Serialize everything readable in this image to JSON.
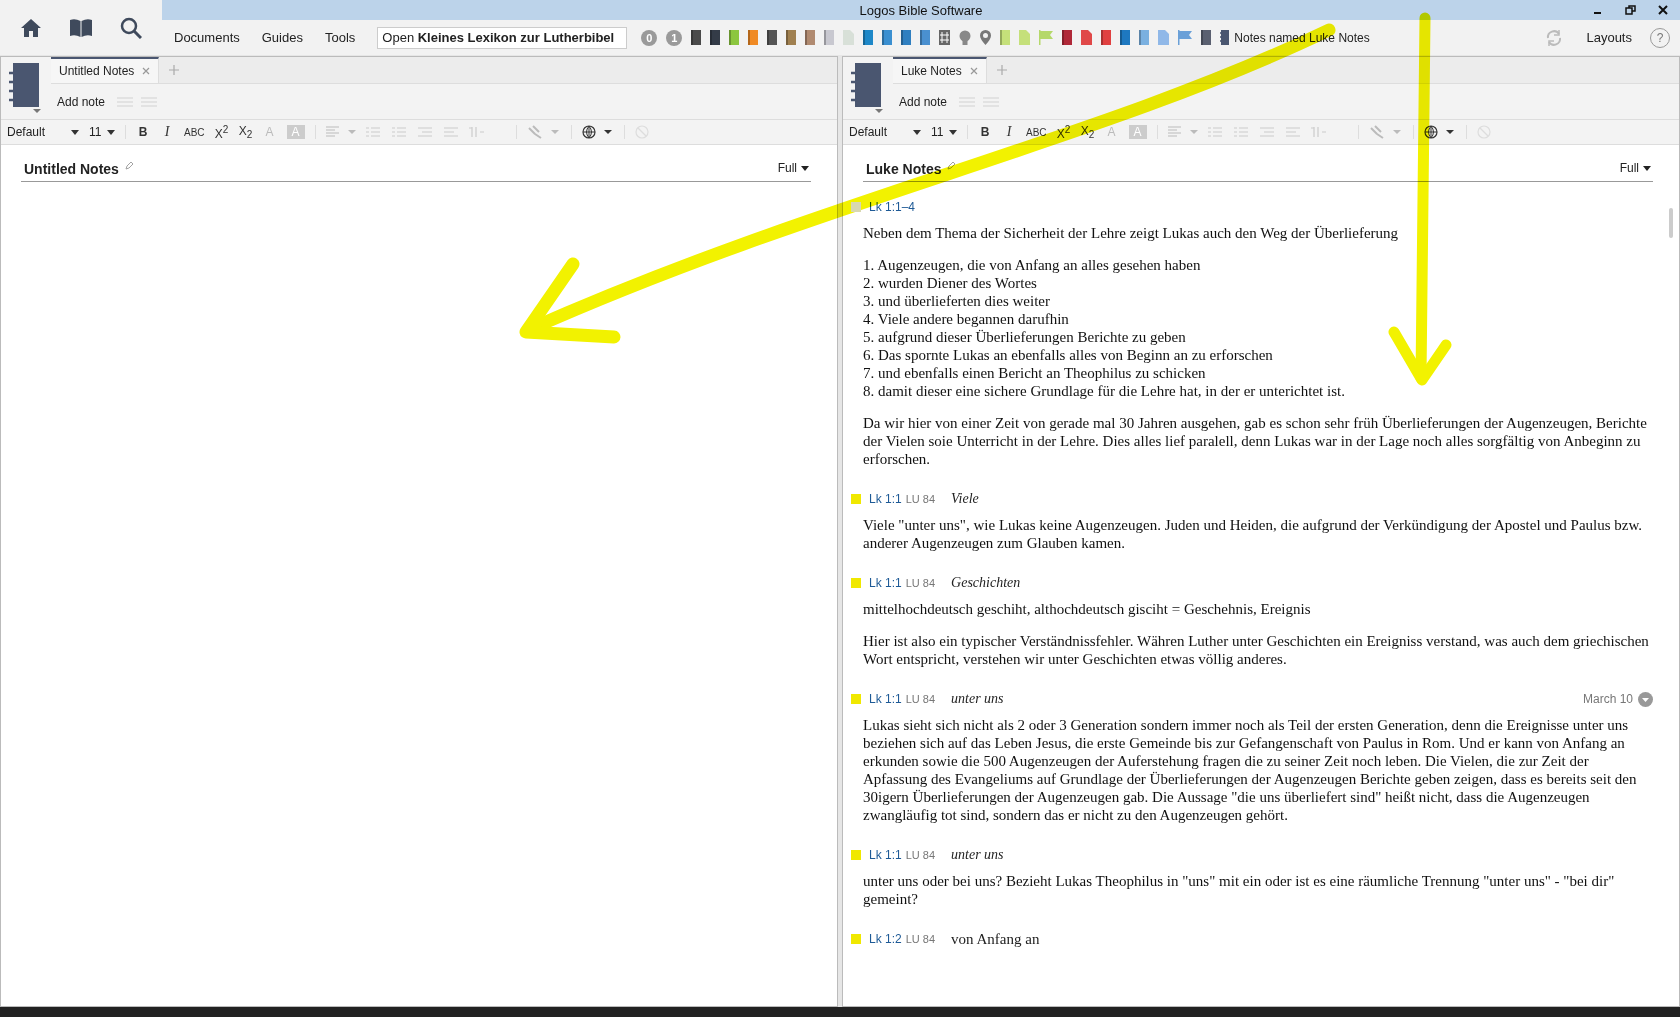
{
  "window": {
    "title": "Logos Bible Software"
  },
  "menu": [
    {
      "label": "Documents"
    },
    {
      "label": "Guides"
    },
    {
      "label": "Tools"
    }
  ],
  "command_box": {
    "value": "Open **Kleines Lexikon zur Lutherbibel**"
  },
  "shortcuts": [
    {
      "kind": "badge",
      "label": "0",
      "color": "#9a9a9a"
    },
    {
      "kind": "badge",
      "label": "1",
      "color": "#9a9a9a"
    },
    {
      "kind": "book",
      "color": "#4a4a4a"
    },
    {
      "kind": "book",
      "color": "#343c48"
    },
    {
      "kind": "book",
      "color": "#8cc63f"
    },
    {
      "kind": "book",
      "color": "#f08a24"
    },
    {
      "kind": "book",
      "color": "#555555"
    },
    {
      "kind": "book",
      "color": "#a08050"
    },
    {
      "kind": "book",
      "color": "#b08a70"
    },
    {
      "kind": "book",
      "color": "#c8c8d0"
    },
    {
      "kind": "doc",
      "color": "#d8e0d8"
    },
    {
      "kind": "book",
      "color": "#1e88c8"
    },
    {
      "kind": "book",
      "color": "#3a8fd0"
    },
    {
      "kind": "book",
      "color": "#2f7fc0"
    },
    {
      "kind": "book",
      "color": "#4a90d0"
    },
    {
      "kind": "grid",
      "color": "#666666"
    },
    {
      "kind": "bulb",
      "color": "#888888"
    },
    {
      "kind": "pin",
      "color": "#777777"
    },
    {
      "kind": "book",
      "color": "#c5e07a"
    },
    {
      "kind": "doc",
      "color": "#c5e07a"
    },
    {
      "kind": "flag",
      "color": "#b5d86a"
    },
    {
      "kind": "book",
      "color": "#b02838"
    },
    {
      "kind": "doc",
      "color": "#e04848"
    },
    {
      "kind": "book",
      "color": "#e04040"
    },
    {
      "kind": "book",
      "color": "#1e78c0"
    },
    {
      "kind": "book",
      "color": "#7ab0e0"
    },
    {
      "kind": "doc",
      "color": "#90b8e8"
    },
    {
      "kind": "flag",
      "color": "#6aa0d8"
    },
    {
      "kind": "book",
      "color": "#5a6070"
    }
  ],
  "notes_shortcut": {
    "label": "Notes named Luke Notes"
  },
  "layouts": {
    "label": "Layouts"
  },
  "help": {
    "label": "?"
  },
  "panels": [
    {
      "tab": {
        "label": "Untitled Notes",
        "selected": true
      },
      "add_note": "Add note",
      "toolbar": {
        "font": "Default",
        "size": "11",
        "buttons": [
          {
            "kind": "bold",
            "label": "B",
            "disabled": false
          },
          {
            "kind": "italic",
            "label": "I",
            "disabled": false
          },
          {
            "kind": "caps",
            "label": "ABC",
            "disabled": false
          },
          {
            "kind": "sup",
            "label": "X$^{2}$",
            "disabled": false
          },
          {
            "kind": "sub",
            "label": "X$_{2}$",
            "disabled": false
          },
          {
            "kind": "color",
            "label": "A",
            "disabled": true
          },
          {
            "kind": "highlight",
            "label": "A",
            "disabled": true
          }
        ]
      },
      "title": "Untitled Notes",
      "view": "Full"
    },
    {
      "tab": {
        "label": "Luke Notes",
        "selected": true
      },
      "add_note": "Add note",
      "toolbar": {
        "font": "Default",
        "size": "11",
        "buttons": [
          {
            "kind": "bold",
            "label": "B",
            "disabled": false
          },
          {
            "kind": "italic",
            "label": "I",
            "disabled": false
          },
          {
            "kind": "caps",
            "label": "ABC",
            "disabled": false
          },
          {
            "kind": "sup",
            "label": "X$^{2}$",
            "disabled": false
          },
          {
            "kind": "sub",
            "label": "X$_{2}$",
            "disabled": false
          },
          {
            "kind": "color",
            "label": "A",
            "disabled": true
          },
          {
            "kind": "highlight",
            "label": "A",
            "disabled": true
          }
        ]
      },
      "title": "Luke Notes",
      "view": "Full",
      "notes": [
        {
          "reference": "Lk 1:1–4",
          "color": "#d8d8b0",
          "paragraphs": [
            [
              "Neben dem Thema der Sicherheit der Lehre zeigt Lukas auch den Weg der Überlieferung"
            ],
            [
              "1. Augenzeugen, die von Anfang an alles gesehen haben",
              "2. wurden Diener des Wortes",
              "3. und überlieferten dies weiter",
              "4. Viele andere begannen darufhin",
              "5. aufgrund dieser Überlieferungen Berichte zu geben",
              "6. Das spornte Lukas an ebenfalls alles von Beginn an zu erforschen",
              "7. und ebenfalls einen Bericht an Theophilus zu schicken",
              "8. damit dieser eine sichere Grundlage für die Lehre hat, in der er unterichtet ist."
            ],
            [
              "Da wir hier von einer Zeit von gerade mal 30 Jahren ausgehen, gab es schon sehr früh Überlieferungen der Augenzeugen, Berichte der Vielen soie Unterricht in der Lehre. Dies alles lief paralell, denn Lukas war in der Lage noch alles sorgfältig von Anbeginn zu erforschen."
            ]
          ]
        },
        {
          "reference": "Lk 1:1",
          "version": "LU 84",
          "heading": "Viele",
          "heading_italic": true,
          "color": "#f0e800",
          "paragraphs": [
            [
              "Viele \"unter uns\", wie Lukas keine Augenzeugen. Juden und Heiden, die aufgrund der Verkündigung der Apostel und Paulus bzw. anderer Augenzeugen zum Glauben kamen."
            ]
          ]
        },
        {
          "reference": "Lk 1:1",
          "version": "LU 84",
          "heading": "Geschichten",
          "heading_italic": true,
          "color": "#f0e800",
          "paragraphs": [
            [
              "mittelhochdeutsch geschiht, althochdeutsch gisciht = Geschehnis, Ereignis"
            ],
            [
              "Hier ist also ein typischer Verständnissfehler. Währen Luther unter Geschichten ein Ereigniss verstand, was auch dem griechischen Wort entspricht, verstehen wir unter Geschichten etwas völlig anderes."
            ]
          ]
        },
        {
          "reference": "Lk 1:1",
          "version": "LU 84",
          "heading": "unter uns",
          "heading_italic": true,
          "color": "#f0e800",
          "date": "March 10",
          "paragraphs": [
            [
              "Lukas sieht sich nicht als 2 oder 3 Generation sondern immer noch als Teil der ersten Generation, denn die Ereignisse unter uns beziehen sich auf das Leben Jesus, die erste Gemeinde bis zur Gefangenschaft von Paulus in Rom. Und er kann von Anfang an erkunden sowie die 500 Augenzeugen der Auferstehung fragen die zu seiner Zeit noch leben. Die Vielen, die zur Zeit der Apfassung des Evangeliums auf Grundlage der Überlieferungen der Augenzeugen Berichte geben zeigen, dass es bereits seit den 30igern Überlieferungen der Augenzeugen gab. Die Aussage \"die uns überliefert sind\" heißt nicht, dass die Augenzeugen zwangläufig tot sind, sondern das er nicht zu den Augenzeugen gehört."
            ]
          ]
        },
        {
          "reference": "Lk 1:1",
          "version": "LU 84",
          "heading": "unter uns",
          "heading_italic": true,
          "color": "#f0e800",
          "paragraphs": [
            [
              "unter uns oder bei uns? Bezieht Lukas Theophilus in \"uns\" mit ein oder ist es eine räumliche Trennung \"unter uns\" - \"bei dir\" gemeint?"
            ]
          ]
        },
        {
          "reference": "Lk 1:2",
          "version": "LU 84",
          "heading": "von Anfang an",
          "heading_italic": false,
          "color": "#f0e800"
        }
      ]
    }
  ]
}
